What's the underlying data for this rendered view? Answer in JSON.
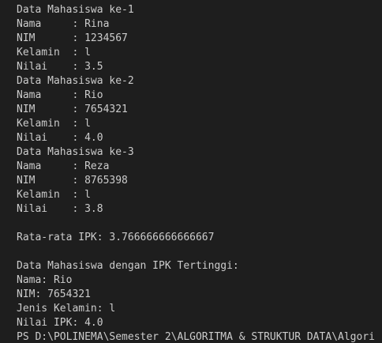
{
  "terminal": {
    "lines": [
      "Data Mahasiswa ke-1",
      "Nama     : Rina",
      "NIM      : 1234567",
      "Kelamin  : l",
      "Nilai    : 3.5",
      "Data Mahasiswa ke-2",
      "Nama     : Rio",
      "NIM      : 7654321",
      "Kelamin  : l",
      "Nilai    : 4.0",
      "Data Mahasiswa ke-3",
      "Nama     : Reza",
      "NIM      : 8765398",
      "Kelamin  : l",
      "Nilai    : 3.8",
      "",
      "Rata-rata IPK: 3.766666666666667",
      "",
      "Data Mahasiswa dengan IPK Tertinggi:",
      "Nama: Rio",
      "NIM: 7654321",
      "Jenis Kelamin: l",
      "Nilai IPK: 4.0",
      "PS D:\\POLINEMA\\Semester 2\\ALGORITMA & STRUKTUR DATA\\Algori"
    ],
    "colors": {
      "background": "#1e1e1e",
      "foreground": "#cccccc"
    }
  }
}
